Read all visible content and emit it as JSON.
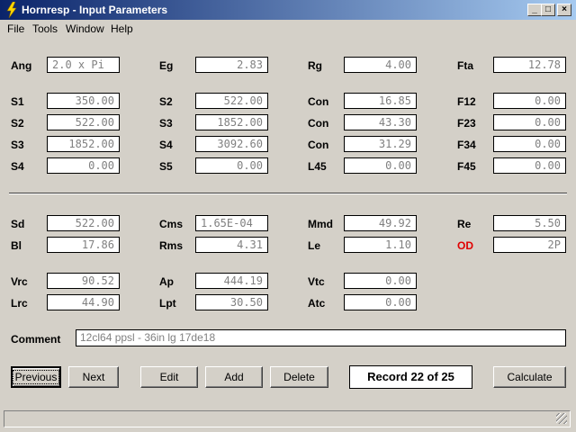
{
  "window": {
    "title": "Hornresp - Input Parameters",
    "minimize": "_",
    "maximize": "□",
    "close": "×"
  },
  "menu": {
    "file": "File",
    "tools": "Tools",
    "window": "Window",
    "help": "Help"
  },
  "params": {
    "ang": {
      "label": "Ang",
      "value": "2.0 x Pi"
    },
    "eg": {
      "label": "Eg",
      "value": "2.83"
    },
    "rg": {
      "label": "Rg",
      "value": "4.00"
    },
    "fta": {
      "label": "Fta",
      "value": "12.78"
    },
    "s1_l": {
      "label": "S1",
      "value": "350.00"
    },
    "s2_m": {
      "label": "S2",
      "value": "522.00"
    },
    "con1": {
      "label": "Con",
      "value": "16.85"
    },
    "f12": {
      "label": "F12",
      "value": "0.00"
    },
    "s2_l": {
      "label": "S2",
      "value": "522.00"
    },
    "s3_m": {
      "label": "S3",
      "value": "1852.00"
    },
    "con2": {
      "label": "Con",
      "value": "43.30"
    },
    "f23": {
      "label": "F23",
      "value": "0.00"
    },
    "s3_l": {
      "label": "S3",
      "value": "1852.00"
    },
    "s4_m": {
      "label": "S4",
      "value": "3092.60"
    },
    "con3": {
      "label": "Con",
      "value": "31.29"
    },
    "f34": {
      "label": "F34",
      "value": "0.00"
    },
    "s4_l": {
      "label": "S4",
      "value": "0.00"
    },
    "s5_m": {
      "label": "S5",
      "value": "0.00"
    },
    "l45": {
      "label": "L45",
      "value": "0.00"
    },
    "f45": {
      "label": "F45",
      "value": "0.00"
    },
    "sd": {
      "label": "Sd",
      "value": "522.00"
    },
    "cms": {
      "label": "Cms",
      "value": "1.65E-04"
    },
    "mmd": {
      "label": "Mmd",
      "value": "49.92"
    },
    "re": {
      "label": "Re",
      "value": "5.50"
    },
    "bl": {
      "label": "Bl",
      "value": "17.86"
    },
    "rms": {
      "label": "Rms",
      "value": "4.31"
    },
    "le": {
      "label": "Le",
      "value": "1.10"
    },
    "od": {
      "label": "OD",
      "value": "2P"
    },
    "vrc": {
      "label": "Vrc",
      "value": "90.52"
    },
    "ap": {
      "label": "Ap",
      "value": "444.19"
    },
    "vtc": {
      "label": "Vtc",
      "value": "0.00"
    },
    "lrc": {
      "label": "Lrc",
      "value": "44.90"
    },
    "lpt": {
      "label": "Lpt",
      "value": "30.50"
    },
    "atc": {
      "label": "Atc",
      "value": "0.00"
    }
  },
  "comment": {
    "label": "Comment",
    "value": "12cl64 ppsl - 36in lg 17de18"
  },
  "buttons": {
    "previous": "Previous",
    "next": "Next",
    "edit": "Edit",
    "add": "Add",
    "delete": "Delete",
    "calculate": "Calculate"
  },
  "record": "Record 22 of 25",
  "colors": {
    "titlebar": "#0a246a",
    "od_label": "#e00000",
    "face": "#d4d0c8"
  }
}
